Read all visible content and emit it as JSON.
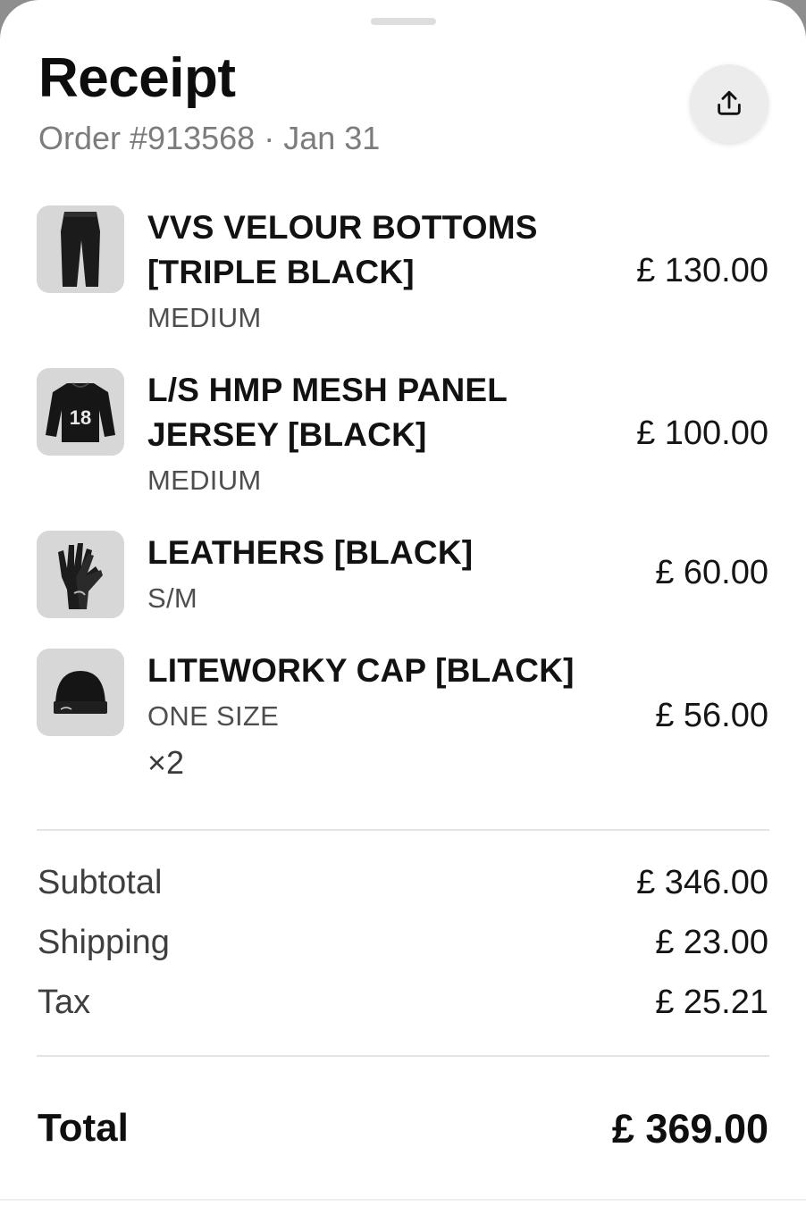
{
  "header": {
    "title": "Receipt",
    "order_label": "Order #913568",
    "separator": "·",
    "date": "Jan 31",
    "share_icon": "share-upload-icon"
  },
  "items": [
    {
      "name": "VVS VELOUR BOTTOMS [TRIPLE BLACK]",
      "variant": "MEDIUM",
      "quantity": "",
      "price": "£ 130.00",
      "thumb_icon": "velour-bottoms-thumbnail"
    },
    {
      "name": "L/S HMP MESH PANEL JERSEY [BLACK]",
      "variant": "MEDIUM",
      "quantity": "",
      "price": "£ 100.00",
      "thumb_icon": "mesh-jersey-thumbnail",
      "thumb_text": "18"
    },
    {
      "name": "LEATHERS [BLACK]",
      "variant": "S/M",
      "quantity": "",
      "price": "£ 60.00",
      "thumb_icon": "leather-gloves-thumbnail"
    },
    {
      "name": "LITEWORKY CAP [BLACK]",
      "variant": "ONE SIZE",
      "quantity": "×2",
      "price": "£ 56.00",
      "thumb_icon": "beanie-cap-thumbnail"
    }
  ],
  "summary": {
    "subtotal_label": "Subtotal",
    "subtotal_value": "£ 346.00",
    "shipping_label": "Shipping",
    "shipping_value": "£ 23.00",
    "tax_label": "Tax",
    "tax_value": "£ 25.21",
    "total_label": "Total",
    "total_value": "£ 369.00"
  },
  "colors": {
    "backdrop": "#8e8e8e",
    "sheet": "#ffffff",
    "thumb_bg": "#d7d7d7",
    "muted_text": "#7c7c7c",
    "divider": "#e4e4e4"
  }
}
